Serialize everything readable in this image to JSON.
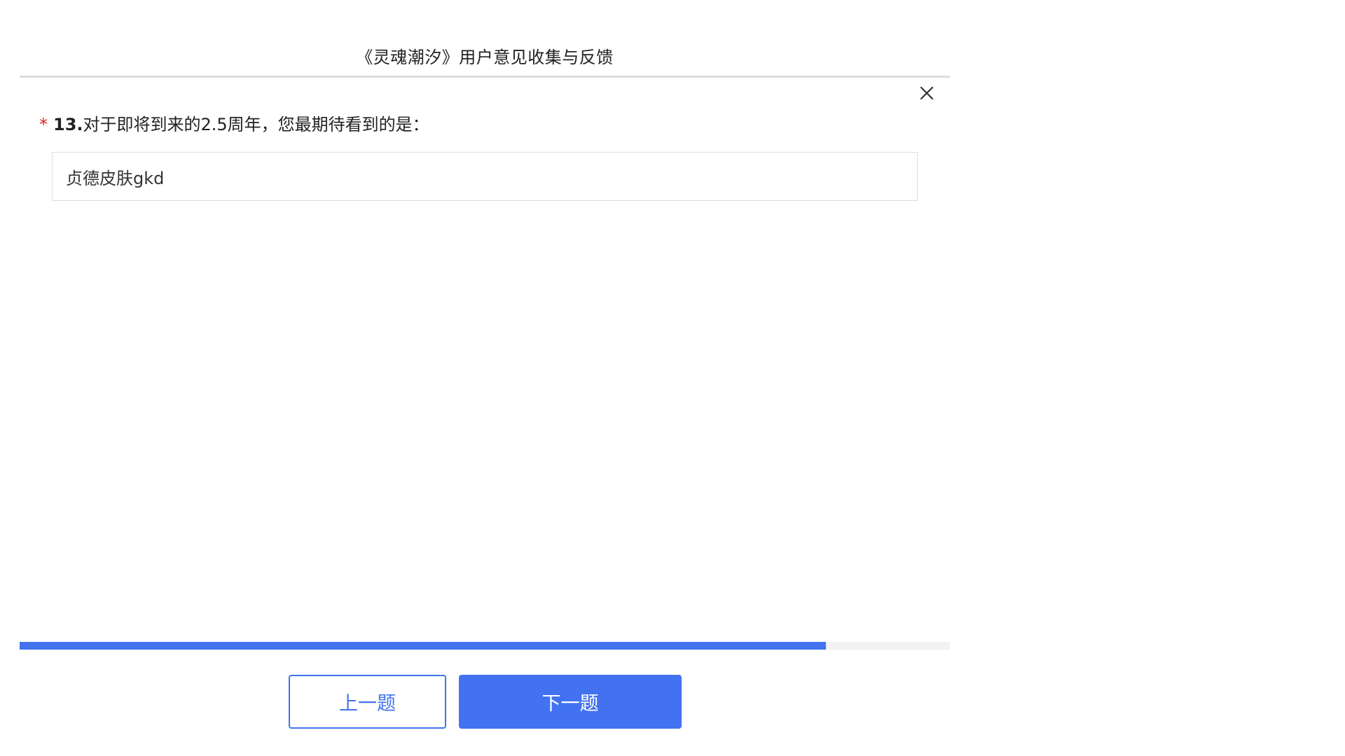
{
  "header": {
    "title": "《灵魂潮汐》用户意见收集与反馈"
  },
  "question": {
    "required_mark": "*",
    "number": "13.",
    "text": "对于即将到来的2.5周年，您最期待看到的是："
  },
  "answer": {
    "value": "贞德皮肤gkd"
  },
  "progress": {
    "fraction": 0.867
  },
  "navigation": {
    "prev_label": "上一题",
    "next_label": "下一题"
  },
  "icons": {
    "close": "close-icon"
  },
  "colors": {
    "accent": "#4272f0",
    "required": "#e02020",
    "progress_track": "#f2f2f2"
  }
}
